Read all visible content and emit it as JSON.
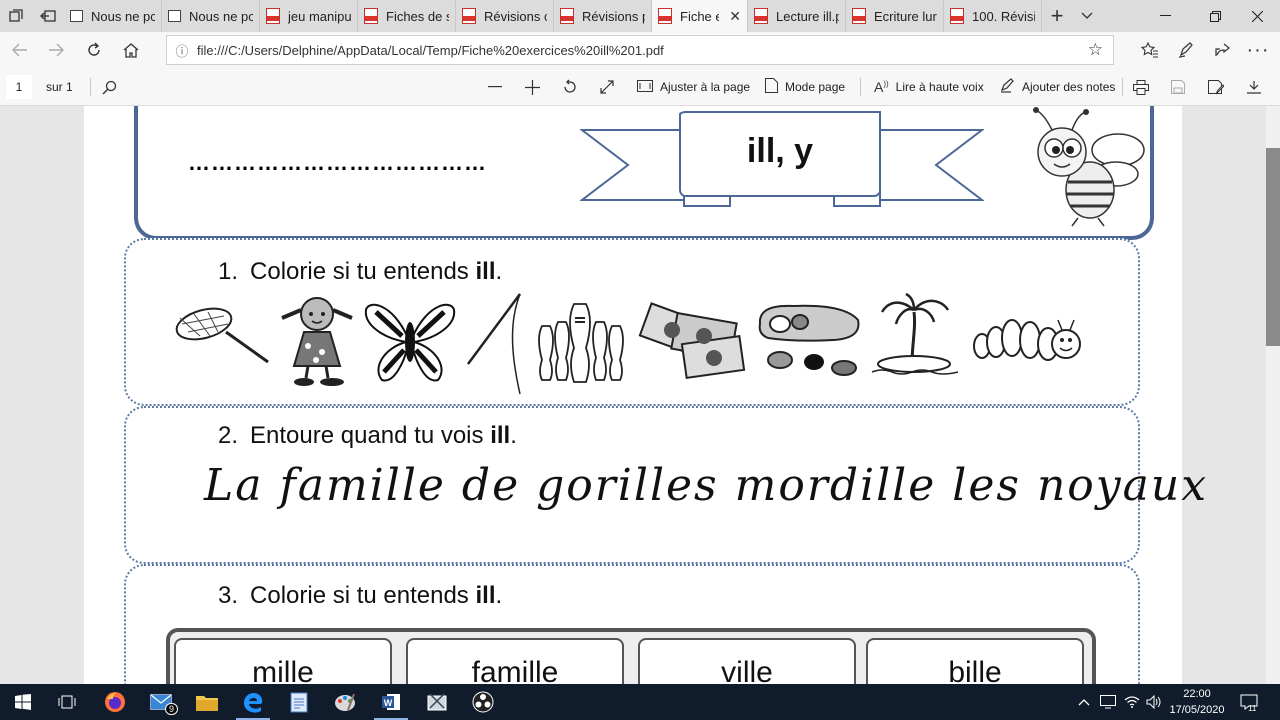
{
  "browser": {
    "tabs": [
      {
        "label": "Nous ne pc",
        "icon": "page-icon"
      },
      {
        "label": "Nous ne pc",
        "icon": "page-icon"
      },
      {
        "label": "jeu manipu",
        "icon": "pdf-icon"
      },
      {
        "label": "Fiches de s",
        "icon": "pdf-icon"
      },
      {
        "label": "Révisions c",
        "icon": "pdf-icon"
      },
      {
        "label": "Révisions p",
        "icon": "pdf-icon"
      },
      {
        "label": "Fiche e",
        "icon": "pdf-icon",
        "active": true
      },
      {
        "label": "Lecture ill.p",
        "icon": "pdf-icon"
      },
      {
        "label": "Ecriture lur",
        "icon": "pdf-icon"
      },
      {
        "label": "100. Révisic",
        "icon": "pdf-icon"
      }
    ],
    "new_tab": "+",
    "url": "file:///C:/Users/Delphine/AppData/Local/Temp/Fiche%20exercices%20ill%201.pdf"
  },
  "pdf_toolbar": {
    "page_number": "1",
    "page_total": "sur 1",
    "fit_page": "Ajuster à la page",
    "page_mode": "Mode page",
    "read_aloud": "Lire à haute voix",
    "add_notes": "Ajouter des notes"
  },
  "document": {
    "name_dots": "…………………………………",
    "banner": "ill, y",
    "sections": [
      {
        "number": "1.",
        "text": "Colorie si tu entends ",
        "bold": "ill",
        "end": "."
      },
      {
        "number": "2.",
        "text": "Entoure quand tu vois ",
        "bold": "ill",
        "end": "."
      },
      {
        "number": "3.",
        "text": "Colorie si tu entends ",
        "bold": "ill",
        "end": "."
      }
    ],
    "cursive_sentence": "La famille de gorilles mordille les noyaux",
    "words": [
      "mille",
      "famille",
      "ville",
      "bille"
    ]
  },
  "taskbar": {
    "mail_badge": "9",
    "time": "22:00",
    "date": "17/05/2020",
    "notification_count": "11"
  },
  "colors": {
    "frame_blue": "#4d6896",
    "dotted_blue": "#5d7aa6",
    "pdf_red": "#d9332b",
    "taskbar": "#101c2c"
  }
}
